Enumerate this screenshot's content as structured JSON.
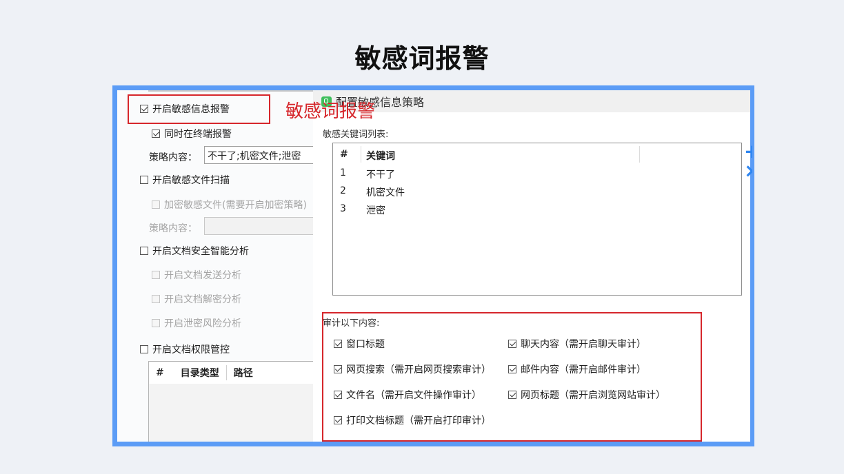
{
  "slide": {
    "title": "敏感词报警"
  },
  "overlay": {
    "label": "敏感词报警"
  },
  "left_panel": {
    "enable_sensitive_alert": {
      "label": "开启敏感信息报警",
      "checked": true
    },
    "alert_on_terminal": {
      "label": "同时在终端报警",
      "checked": true
    },
    "policy_content_1": {
      "label": "策略内容：",
      "value": "不干了;机密文件;泄密"
    },
    "enable_file_scan": {
      "label": "开启敏感文件扫描",
      "checked": false
    },
    "encrypt_files": {
      "label": "加密敏感文件(需要开启加密策略)",
      "checked": false
    },
    "policy_content_2": {
      "label": "策略内容：",
      "value": ""
    },
    "enable_doc_analysis": {
      "label": "开启文档安全智能分析",
      "checked": false
    },
    "doc_send_analysis": {
      "label": "开启文档发送分析",
      "checked": false
    },
    "doc_decrypt_analysis": {
      "label": "开启文档解密分析",
      "checked": false
    },
    "leak_risk_analysis": {
      "label": "开启泄密风险分析",
      "checked": false
    },
    "enable_doc_permission": {
      "label": "开启文档权限管控",
      "checked": false
    },
    "dir_table": {
      "columns": [
        "#",
        "目录类型",
        "路径"
      ]
    }
  },
  "dialog": {
    "title": "配置敏感信息策略",
    "keyword_list_label": "敏感关键词列表:",
    "keyword_table": {
      "columns": [
        "#",
        "关键词"
      ],
      "rows": [
        {
          "index": "1",
          "keyword": "不干了"
        },
        {
          "index": "2",
          "keyword": "机密文件"
        },
        {
          "index": "3",
          "keyword": "泄密"
        }
      ]
    },
    "audit_label": "审计以下内容:",
    "audit_items": [
      {
        "label": "窗口标题",
        "checked": true
      },
      {
        "label": "聊天内容（需开启聊天审计）",
        "checked": true
      },
      {
        "label": "网页搜索（需开启网页搜索审计）",
        "checked": true
      },
      {
        "label": "邮件内容（需开启邮件审计）",
        "checked": true
      },
      {
        "label": "文件名（需开启文件操作审计）",
        "checked": true
      },
      {
        "label": "网页标题（需开启浏览网站审计）",
        "checked": true
      },
      {
        "label": "打印文档标题（需开启打印审计）",
        "checked": true
      }
    ]
  },
  "colors": {
    "frame": "#5b9cf6",
    "highlight": "#d6262b",
    "accent": "#2f86f1"
  }
}
